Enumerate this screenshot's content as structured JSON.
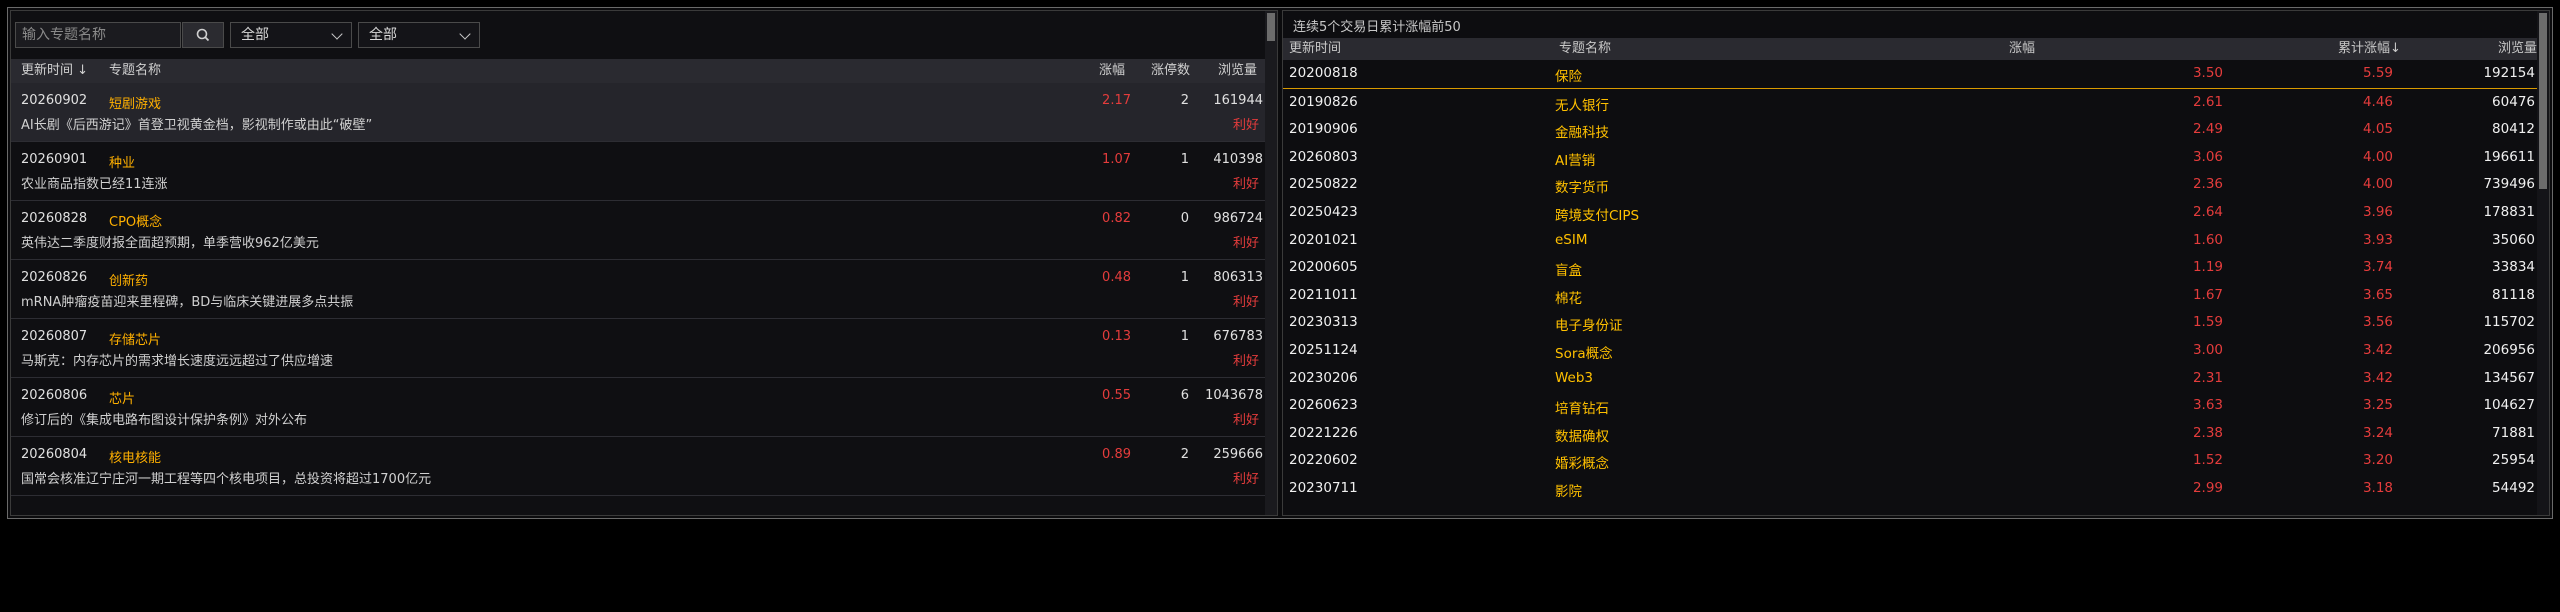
{
  "left_panel": {
    "search": {
      "placeholder": "输入专题名称"
    },
    "filter1": {
      "value": "全部"
    },
    "filter2": {
      "value": "全部"
    },
    "headers": {
      "update_time": "更新时间 ↓",
      "topic_name": "专题名称",
      "change": "涨幅",
      "limit_up": "涨停数",
      "views": "浏览量"
    },
    "rows": [
      {
        "date": "20260902",
        "name": "短剧游戏",
        "change": "2.17",
        "limit_up": "2",
        "views": "161944",
        "news": "AI长剧《后西游记》首登卫视黄金档，影视制作或由此“破壁”",
        "tag": "利好"
      },
      {
        "date": "20260901",
        "name": "种业",
        "change": "1.07",
        "limit_up": "1",
        "views": "410398",
        "news": "农业商品指数已经11连涨",
        "tag": "利好"
      },
      {
        "date": "20260828",
        "name": "CPO概念",
        "change": "0.82",
        "limit_up": "0",
        "views": "986724",
        "news": "英伟达二季度财报全面超预期，单季营收962亿美元",
        "tag": "利好"
      },
      {
        "date": "20260826",
        "name": "创新药",
        "change": "0.48",
        "limit_up": "1",
        "views": "806313",
        "news": "mRNA肿瘤疫苗迎来里程碑，BD与临床关键进展多点共振",
        "tag": "利好"
      },
      {
        "date": "20260807",
        "name": "存储芯片",
        "change": "0.13",
        "limit_up": "1",
        "views": "676783",
        "news": "马斯克：内存芯片的需求增长速度远远超过了供应增速",
        "tag": "利好"
      },
      {
        "date": "20260806",
        "name": "芯片",
        "change": "0.55",
        "limit_up": "6",
        "views": "1043678",
        "news": "修订后的《集成电路布图设计保护条例》对外公布",
        "tag": "利好"
      },
      {
        "date": "20260804",
        "name": "核电核能",
        "change": "0.89",
        "limit_up": "2",
        "views": "259666",
        "news": "国常会核准辽宁庄河一期工程等四个核电项目，总投资将超过1700亿元",
        "tag": "利好"
      }
    ]
  },
  "right_panel": {
    "title": "连续5个交易日累计涨幅前50",
    "headers": {
      "update_time": "更新时间",
      "topic_name": "专题名称",
      "change": "涨幅",
      "cum_change": "累计涨幅↓",
      "views": "浏览量"
    },
    "rows": [
      {
        "date": "20200818",
        "name": "保险",
        "change": "3.50",
        "cum": "5.59",
        "views": "192154"
      },
      {
        "date": "20190826",
        "name": "无人银行",
        "change": "2.61",
        "cum": "4.46",
        "views": "60476"
      },
      {
        "date": "20190906",
        "name": "金融科技",
        "change": "2.49",
        "cum": "4.05",
        "views": "80412"
      },
      {
        "date": "20260803",
        "name": "AI营销",
        "change": "3.06",
        "cum": "4.00",
        "views": "196611"
      },
      {
        "date": "20250822",
        "name": "数字货币",
        "change": "2.36",
        "cum": "4.00",
        "views": "739496"
      },
      {
        "date": "20250423",
        "name": "跨境支付CIPS",
        "change": "2.64",
        "cum": "3.96",
        "views": "178831"
      },
      {
        "date": "20201021",
        "name": "eSIM",
        "change": "1.60",
        "cum": "3.93",
        "views": "35060"
      },
      {
        "date": "20200605",
        "name": "盲盒",
        "change": "1.19",
        "cum": "3.74",
        "views": "33834"
      },
      {
        "date": "20211011",
        "name": "棉花",
        "change": "1.67",
        "cum": "3.65",
        "views": "81118"
      },
      {
        "date": "20230313",
        "name": "电子身份证",
        "change": "1.59",
        "cum": "3.56",
        "views": "115702"
      },
      {
        "date": "20251124",
        "name": "Sora概念",
        "change": "3.00",
        "cum": "3.42",
        "views": "206956"
      },
      {
        "date": "20230206",
        "name": "Web3",
        "change": "2.31",
        "cum": "3.42",
        "views": "134567"
      },
      {
        "date": "20260623",
        "name": "培育钻石",
        "change": "3.63",
        "cum": "3.25",
        "views": "104627"
      },
      {
        "date": "20221226",
        "name": "数据确权",
        "change": "2.38",
        "cum": "3.24",
        "views": "71881"
      },
      {
        "date": "20220602",
        "name": "婚彩概念",
        "change": "1.52",
        "cum": "3.20",
        "views": "25954"
      },
      {
        "date": "20230711",
        "name": "影院",
        "change": "2.99",
        "cum": "3.18",
        "views": "54492"
      }
    ]
  },
  "colors": {
    "accent_yellow": "#ffb000",
    "up_red": "#e43c3c"
  },
  "icons": {
    "search": "search-icon",
    "dropdown": "chevron-down-icon"
  }
}
